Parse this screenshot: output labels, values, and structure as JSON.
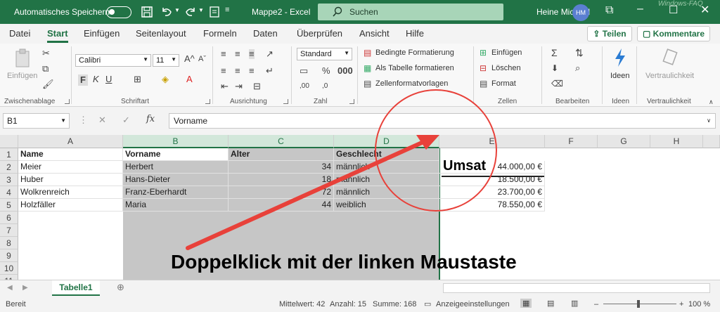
{
  "titlebar": {
    "autosave_label": "Automatisches Speichern",
    "document_title": "Mappe2 - Excel",
    "search_label": "Suchen",
    "user_name": "Heine Michael",
    "user_initials": "HM",
    "watermark": "Windows-FAQ"
  },
  "tabs": [
    "Datei",
    "Start",
    "Einfügen",
    "Seitenlayout",
    "Formeln",
    "Daten",
    "Überprüfen",
    "Ansicht",
    "Hilfe"
  ],
  "active_tab": "Start",
  "share_label": "Teilen",
  "comments_label": "Kommentare",
  "ribbon": {
    "paste_label": "Einfügen",
    "clipboard_label": "Zwischenablage",
    "font_name": "Calibri",
    "font_size": "11",
    "font_label": "Schriftart",
    "bold": "F",
    "italic": "K",
    "underline": "U",
    "alignment_label": "Ausrichtung",
    "number_format": "Standard",
    "number_label": "Zahl",
    "cond_format": "Bedingte Formatierung",
    "as_table": "Als Tabelle formatieren",
    "cell_styles": "Zellenformatvorlagen",
    "insert": "Einfügen",
    "delete": "Löschen",
    "format": "Format",
    "cells_label": "Zellen",
    "editing_label": "Bearbeiten",
    "ideas": "Ideen",
    "ideas_label": "Ideen",
    "sensitivity": "Vertraulichkeit",
    "sensitivity_label": "Vertraulichkeit"
  },
  "formula_bar": {
    "name_box": "B1",
    "fx": "fx",
    "content": "Vorname"
  },
  "columns": [
    "A",
    "B",
    "C",
    "D",
    "E",
    "F",
    "G",
    "H"
  ],
  "rows": [
    "1",
    "2",
    "3",
    "4",
    "5",
    "6",
    "7",
    "8",
    "9",
    "10",
    "11"
  ],
  "table": {
    "headers": [
      "Name",
      "Vorname",
      "Alter",
      "Geschlecht"
    ],
    "rows": [
      [
        "Meier",
        "Herbert",
        "34",
        "männlich",
        "44.000,00 €"
      ],
      [
        "Huber",
        "Hans-Dieter",
        "18",
        "männlich",
        "18.500,00 €"
      ],
      [
        "Wolkrenreich",
        "Franz-Eberhardt",
        "72",
        "männlich",
        "23.700,00 €"
      ],
      [
        "Holzfäller",
        "Maria",
        "44",
        "weiblich",
        "78.550,00 €"
      ]
    ]
  },
  "umsatz_label": "Umsat",
  "sheet_tab": "Tabelle1",
  "statusbar": {
    "ready": "Bereit",
    "average": "Mittelwert: 42",
    "count": "Anzahl: 15",
    "sum": "Summe: 168",
    "display_settings": "Anzeigeeinstellungen",
    "zoom": "100 %"
  },
  "annotation": {
    "caption": "Doppelklick mit der linken Maustaste",
    "arrow_color": "#e8413a",
    "circle_color": "#e8413a"
  },
  "colors": {
    "excel_green": "#217346",
    "selection_gray": "#c6c6c6"
  }
}
